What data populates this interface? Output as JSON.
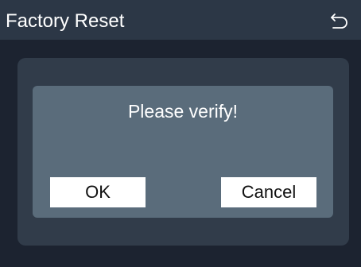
{
  "header": {
    "title": "Factory Reset",
    "back_icon": "return-icon"
  },
  "dialog": {
    "message": "Please verify!",
    "ok_label": "OK",
    "cancel_label": "Cancel"
  },
  "colors": {
    "background": "#1c2330",
    "header": "#2c3746",
    "panel": "#313c4a",
    "dialog": "#5a6c7b",
    "button": "#ffffff",
    "text": "#ffffff"
  }
}
